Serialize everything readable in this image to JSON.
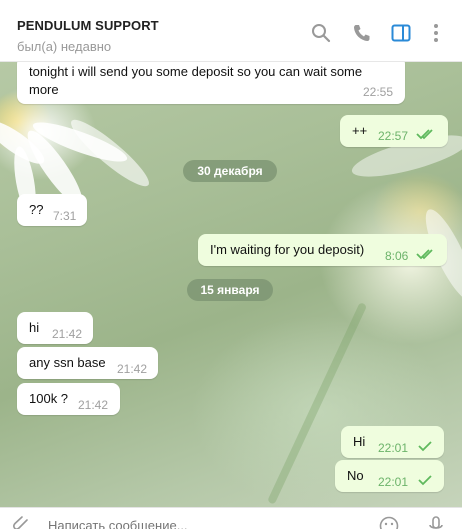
{
  "header": {
    "chat_name": "PENDULUM SUPPORT",
    "status": "был(а) недавно",
    "icons": [
      "search-icon",
      "phone-icon",
      "sidebar-toggle-icon",
      "more-icon"
    ],
    "accent_color": "#2a8ad7"
  },
  "messages": [
    {
      "direction": "in",
      "text_line1": "tonight i will send you some deposit so you can wait some",
      "text_line2": "more",
      "time": "22:55"
    },
    {
      "direction": "out",
      "text": "++",
      "time": "22:57",
      "status": "read"
    },
    {
      "direction": "date",
      "text": "30 декабря"
    },
    {
      "direction": "in",
      "text": "??",
      "time": "7:31"
    },
    {
      "direction": "out",
      "text": "I'm waiting for you deposit)",
      "time": "8:06",
      "status": "read"
    },
    {
      "direction": "date",
      "text": "15 января"
    },
    {
      "direction": "in",
      "text": "hi",
      "time": "21:42"
    },
    {
      "direction": "in",
      "text": "any ssn base",
      "time": "21:42"
    },
    {
      "direction": "in",
      "text": "100k ?",
      "time": "21:42"
    },
    {
      "direction": "out",
      "text": "Hi",
      "time": "22:01",
      "status": "sent"
    },
    {
      "direction": "out",
      "text": "No",
      "time": "22:01",
      "status": "sent"
    }
  ],
  "composer": {
    "placeholder": "Написать сообщение...",
    "icons": [
      "attach-icon",
      "emoji-icon",
      "microphone-icon"
    ]
  },
  "colors": {
    "outgoing_bubble": "#effdde",
    "incoming_bubble": "#ffffff",
    "check_color": "#5fb95d"
  }
}
